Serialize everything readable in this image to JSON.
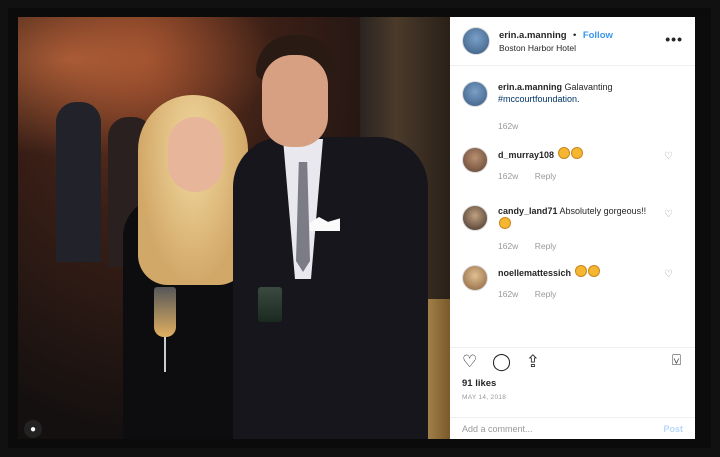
{
  "post": {
    "author": "erin.a.manning",
    "follow_label": "Follow",
    "separator": "•",
    "location": "Boston Harbor Hotel",
    "more_label": "•••",
    "caption": {
      "user": "erin.a.manning",
      "text": "Galavanting",
      "hashtag": "#mccourtfoundation.",
      "age": "162w"
    },
    "comments": [
      {
        "user": "d_murray108",
        "text": "",
        "emoji_count": 2,
        "age": "162w",
        "reply_label": "Reply"
      },
      {
        "user": "candy_land71",
        "text": "Absolutely gorgeous!!",
        "emoji_count": 1,
        "age": "162w",
        "reply_label": "Reply"
      },
      {
        "user": "noellemattessich",
        "text": "",
        "emoji_count": 2,
        "age": "162w",
        "reply_label": "Reply"
      }
    ],
    "likes": "91 likes",
    "date": "MAY 14, 2018",
    "add_comment_placeholder": "Add a comment...",
    "post_label": "Post"
  },
  "icons": {
    "like": "heart-icon",
    "comment": "comment-icon",
    "share": "share-icon",
    "save": "bookmark-icon"
  }
}
